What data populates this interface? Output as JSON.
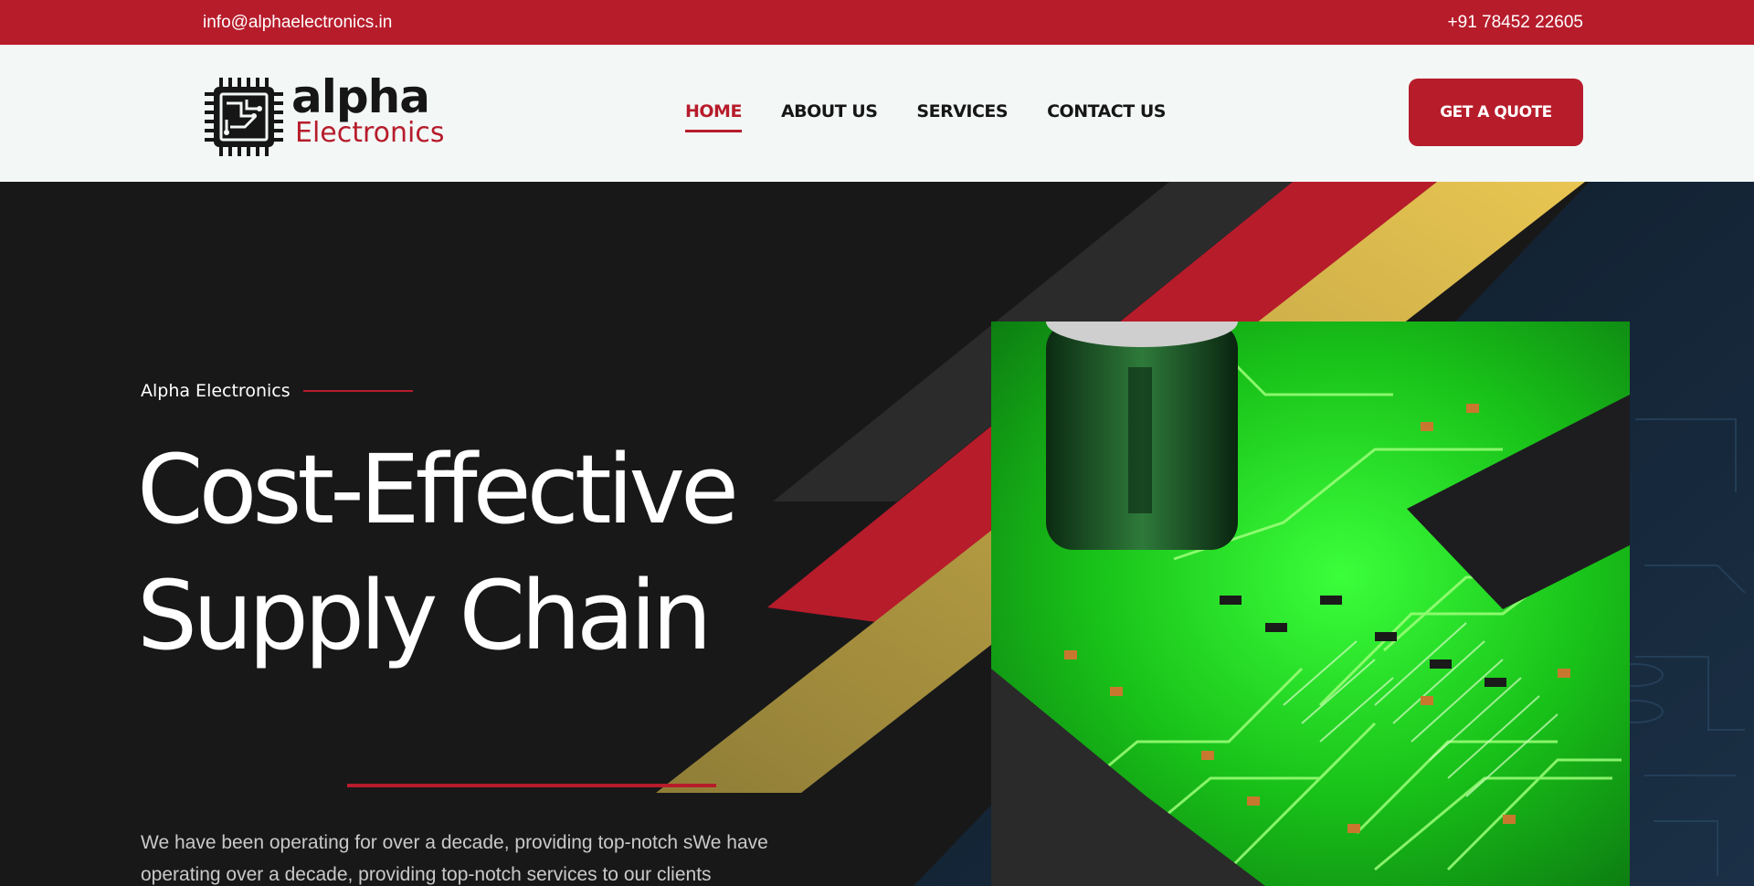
{
  "topbar": {
    "email": "info@alphaelectronics.in",
    "phone": "+91 78452 22605"
  },
  "brand": {
    "logo_word": "alpha",
    "logo_subword": "Electronics",
    "chip_icon": "circuit-chip-icon",
    "colors": {
      "accent": "#b71c2b",
      "gold": "#e9c652",
      "dark": "#181819"
    }
  },
  "nav": {
    "items": [
      {
        "label": "HOME",
        "active": true
      },
      {
        "label": "ABOUT US",
        "active": false
      },
      {
        "label": "SERVICES",
        "active": false
      },
      {
        "label": "CONTACT US",
        "active": false
      }
    ],
    "cta_label": "GET A QUOTE"
  },
  "hero": {
    "eyebrow": "Alpha Electronics",
    "headline_line1": "Cost-Effective",
    "headline_line2": "Supply Chain",
    "description": "We have been operating for over a decade, providing top-notch sWe have operating over a decade, providing top-notch services to our clients",
    "image_subject": "green-circuit-board-photo"
  }
}
